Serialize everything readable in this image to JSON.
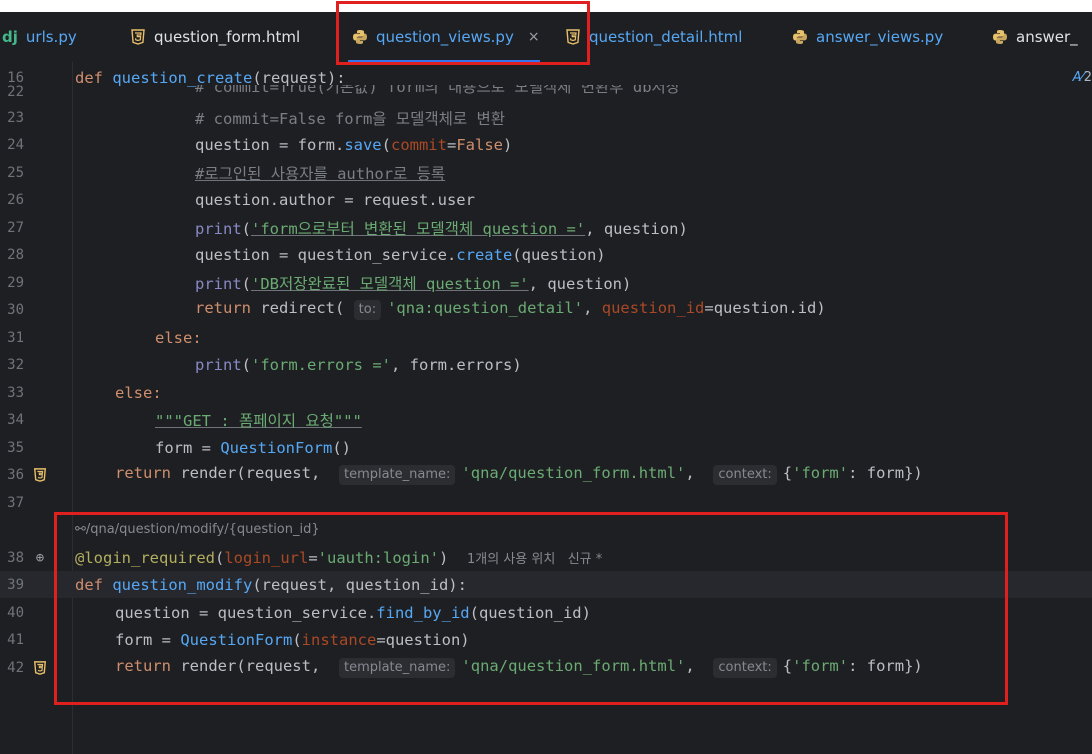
{
  "tabs": [
    {
      "label": "urls.py",
      "icon": "django-icon",
      "active": false
    },
    {
      "label": "question_form.html",
      "icon": "html5-icon",
      "active": false
    },
    {
      "label": "question_views.py",
      "icon": "python-icon",
      "active": true
    },
    {
      "label": "question_detail.html",
      "icon": "html5-icon",
      "active": false
    },
    {
      "label": "answer_views.py",
      "icon": "python-icon",
      "active": false
    },
    {
      "label": "answer_",
      "icon": "python-icon",
      "active": false
    }
  ],
  "close_glyph": "×",
  "sticky_header": {
    "line": "16",
    "text": "def question_create(request):"
  },
  "reader_mode_label": "2",
  "hints": {
    "to": "to:",
    "template_name": "template_name:",
    "context": "context:"
  },
  "lines": {
    "l22": {
      "n": "22",
      "text": "# commit=True(기본값) form의 내용으로 모델객체 변환후 db저장"
    },
    "l23": {
      "n": "23",
      "text": "# commit=False form을 모델객체로 변환"
    },
    "l24": {
      "n": "24"
    },
    "l25": {
      "n": "25",
      "text": "#로그인된 사용자를 author로 등록"
    },
    "l26": {
      "n": "26"
    },
    "l27": {
      "n": "27",
      "str": "'form으로부터 변환된 모델객체 question ='"
    },
    "l28": {
      "n": "28"
    },
    "l29": {
      "n": "29",
      "str": "'DB저장완료된 모델객체 question ='"
    },
    "l30": {
      "n": "30",
      "str": "'qna:question_detail'"
    },
    "l31": {
      "n": "31"
    },
    "l32": {
      "n": "32",
      "str": "'form.errors ='"
    },
    "l33": {
      "n": "33"
    },
    "l34": {
      "n": "34",
      "str": "\"\"\"GET : 폼페이지 요청\"\"\""
    },
    "l35": {
      "n": "35"
    },
    "l36": {
      "n": "36",
      "str": "'qna/question_form.html'"
    },
    "l37": {
      "n": "37"
    },
    "url_hint": "/qna/question/modify/{question_id}",
    "l38": {
      "n": "38",
      "str": "'uauth:login'",
      "usage": "1개의 사용 위치   신규 *"
    },
    "l39": {
      "n": "39"
    },
    "l40": {
      "n": "40"
    },
    "l41": {
      "n": "41"
    },
    "l42": {
      "n": "42",
      "str": "'qna/question_form.html'"
    }
  }
}
